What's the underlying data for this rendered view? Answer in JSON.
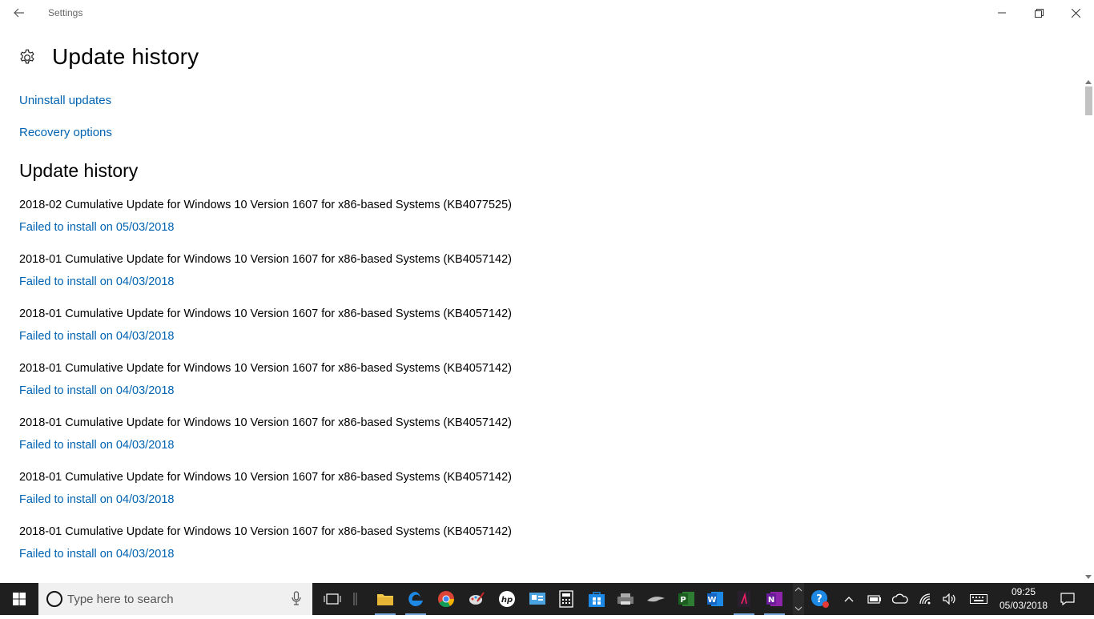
{
  "window": {
    "title": "Settings"
  },
  "header": {
    "title": "Update history",
    "icon": "gear-icon"
  },
  "links": {
    "uninstall": "Uninstall updates",
    "recovery": "Recovery options"
  },
  "history": {
    "section_title": "Update history",
    "items": [
      {
        "name": "2018-02 Cumulative Update for Windows 10 Version 1607 for x86-based Systems (KB4077525)",
        "status": "Failed to install on 05/03/2018"
      },
      {
        "name": "2018-01 Cumulative Update for Windows 10 Version 1607 for x86-based Systems (KB4057142)",
        "status": "Failed to install on 04/03/2018"
      },
      {
        "name": "2018-01 Cumulative Update for Windows 10 Version 1607 for x86-based Systems (KB4057142)",
        "status": "Failed to install on 04/03/2018"
      },
      {
        "name": "2018-01 Cumulative Update for Windows 10 Version 1607 for x86-based Systems (KB4057142)",
        "status": "Failed to install on 04/03/2018"
      },
      {
        "name": "2018-01 Cumulative Update for Windows 10 Version 1607 for x86-based Systems (KB4057142)",
        "status": "Failed to install on 04/03/2018"
      },
      {
        "name": "2018-01 Cumulative Update for Windows 10 Version 1607 for x86-based Systems (KB4057142)",
        "status": "Failed to install on 04/03/2018"
      },
      {
        "name": "2018-01 Cumulative Update for Windows 10 Version 1607 for x86-based Systems (KB4057142)",
        "status": "Failed to install on 04/03/2018"
      }
    ]
  },
  "taskbar": {
    "search_placeholder": "Type here to search",
    "pinned": [
      "task-view-icon",
      "file-explorer-icon",
      "edge-icon",
      "chrome-icon",
      "paint-icon",
      "hp-icon",
      "control-panel-icon",
      "calculator-icon",
      "store-icon",
      "printer-icon",
      "shark-icon",
      "publisher-icon",
      "word-icon",
      "app-icon",
      "onenote-icon"
    ],
    "time": "09:25",
    "date": "05/03/2018"
  },
  "colors": {
    "accent_link": "#0063b1",
    "taskbar_bg": "#1f1f1f"
  }
}
